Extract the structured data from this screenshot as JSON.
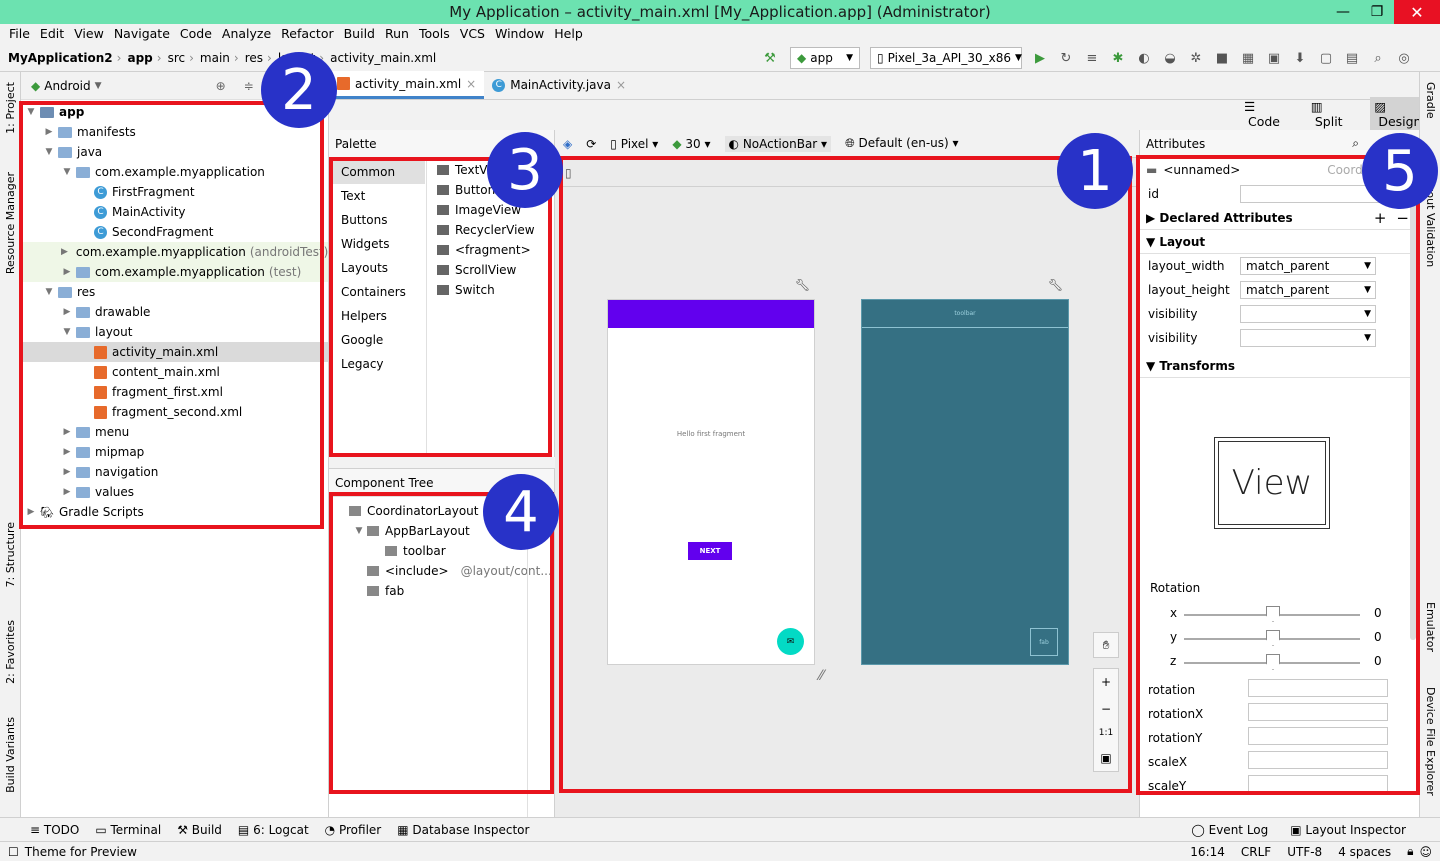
{
  "window": {
    "title": "My Application – activity_main.xml [My_Application.app] (Administrator)",
    "min": "—",
    "restore": "❐",
    "close": "✕"
  },
  "menu": [
    "File",
    "Edit",
    "View",
    "Navigate",
    "Code",
    "Analyze",
    "Refactor",
    "Build",
    "Run",
    "Tools",
    "VCS",
    "Window",
    "Help"
  ],
  "breadcrumbs": [
    "MyApplication2",
    "app",
    "src",
    "main",
    "res",
    "layout",
    "activity_main.xml"
  ],
  "run": {
    "config": "app",
    "device": "Pixel_3a_API_30_x86"
  },
  "left_strip": [
    "1: Project",
    "Resource Manager",
    "7: Structure",
    "2: Favorites",
    "Build Variants"
  ],
  "right_strip": [
    "Gradle",
    "Layout Validation",
    "Emulator",
    "Device File Explorer"
  ],
  "project": {
    "view": "Android",
    "tree": [
      {
        "label": "app",
        "depth": 0,
        "type": "module",
        "arrow": "▼"
      },
      {
        "label": "manifests",
        "depth": 1,
        "type": "folder",
        "arrow": "▶"
      },
      {
        "label": "java",
        "depth": 1,
        "type": "folder",
        "arrow": "▼"
      },
      {
        "label": "com.example.myapplication",
        "depth": 2,
        "type": "folder",
        "arrow": "▼"
      },
      {
        "label": "FirstFragment",
        "depth": 3,
        "type": "class",
        "arrow": ""
      },
      {
        "label": "MainActivity",
        "depth": 3,
        "type": "class",
        "arrow": ""
      },
      {
        "label": "SecondFragment",
        "depth": 3,
        "type": "class",
        "arrow": ""
      },
      {
        "label": "com.example.myapplication",
        "suffix": "(androidTest)",
        "depth": 2,
        "type": "folder",
        "arrow": "▶",
        "test": true
      },
      {
        "label": "com.example.myapplication",
        "suffix": "(test)",
        "depth": 2,
        "type": "folder",
        "arrow": "▶",
        "test": true
      },
      {
        "label": "res",
        "depth": 1,
        "type": "folder",
        "arrow": "▼"
      },
      {
        "label": "drawable",
        "depth": 2,
        "type": "folder",
        "arrow": "▶"
      },
      {
        "label": "layout",
        "depth": 2,
        "type": "folder",
        "arrow": "▼"
      },
      {
        "label": "activity_main.xml",
        "depth": 3,
        "type": "xml",
        "arrow": "",
        "selected": true
      },
      {
        "label": "content_main.xml",
        "depth": 3,
        "type": "xml",
        "arrow": ""
      },
      {
        "label": "fragment_first.xml",
        "depth": 3,
        "type": "xml",
        "arrow": ""
      },
      {
        "label": "fragment_second.xml",
        "depth": 3,
        "type": "xml",
        "arrow": ""
      },
      {
        "label": "menu",
        "depth": 2,
        "type": "folder",
        "arrow": "▶"
      },
      {
        "label": "mipmap",
        "depth": 2,
        "type": "folder",
        "arrow": "▶"
      },
      {
        "label": "navigation",
        "depth": 2,
        "type": "folder",
        "arrow": "▶"
      },
      {
        "label": "values",
        "depth": 2,
        "type": "folder",
        "arrow": "▶"
      },
      {
        "label": "Gradle Scripts",
        "depth": 0,
        "type": "gradle",
        "arrow": "▶"
      }
    ]
  },
  "tabs": [
    {
      "label": "activity_main.xml",
      "active": true
    },
    {
      "label": "MainActivity.java",
      "active": false
    }
  ],
  "view_modes": {
    "code": "Code",
    "split": "Split",
    "design": "Design"
  },
  "palette": {
    "title": "Palette",
    "categories": [
      "Common",
      "Text",
      "Buttons",
      "Widgets",
      "Layouts",
      "Containers",
      "Helpers",
      "Google",
      "Legacy"
    ],
    "items": [
      "TextView",
      "Button",
      "ImageView",
      "RecyclerView",
      "<fragment>",
      "ScrollView",
      "Switch"
    ]
  },
  "design_toolbar": {
    "device": "Pixel",
    "api": "30",
    "theme": "NoActionBar",
    "locale": "Default (en-us)"
  },
  "preview": {
    "text": "Hello first fragment",
    "button": "NEXT",
    "blueprint_toolbar": "toolbar",
    "blueprint_fab": "fab"
  },
  "zoom": {
    "one_to_one": "1:1"
  },
  "component_tree": {
    "title": "Component Tree",
    "nodes": [
      {
        "label": "CoordinatorLayout",
        "depth": 0,
        "arrow": ""
      },
      {
        "label": "AppBarLayout",
        "depth": 1,
        "arrow": "▼"
      },
      {
        "label": "toolbar",
        "depth": 2,
        "arrow": ""
      },
      {
        "label": "<include>",
        "suffix": "@layout/cont...",
        "depth": 1,
        "arrow": ""
      },
      {
        "label": "fab",
        "depth": 1,
        "arrow": ""
      }
    ]
  },
  "attributes": {
    "title": "Attributes",
    "component": "<unnamed>",
    "component_type": "Coordina",
    "id_label": "id",
    "declared": "Declared Attributes",
    "layout": "Layout",
    "layout_rows": [
      {
        "label": "layout_width",
        "value": "match_parent"
      },
      {
        "label": "layout_height",
        "value": "match_parent"
      },
      {
        "label": "visibility",
        "value": ""
      },
      {
        "label": "visibility",
        "value": ""
      }
    ],
    "transforms": "Transforms",
    "view_label": "View",
    "rotation": "Rotation",
    "axes": [
      {
        "label": "x",
        "value": "0"
      },
      {
        "label": "y",
        "value": "0"
      },
      {
        "label": "z",
        "value": "0"
      }
    ],
    "fields": [
      "rotation",
      "rotationX",
      "rotationY",
      "scaleX",
      "scaleY"
    ]
  },
  "bottom_tools": [
    "TODO",
    "Terminal",
    "Build",
    "6: Logcat",
    "Profiler",
    "Database Inspector"
  ],
  "bottom_right": [
    "Event Log",
    "Layout Inspector"
  ],
  "status": {
    "message": "Theme for Preview",
    "position": "16:14",
    "line_sep": "CRLF",
    "encoding": "UTF-8",
    "indent": "4 spaces"
  },
  "callouts": [
    "1",
    "2",
    "3",
    "4",
    "5"
  ],
  "colors": {
    "titlebar": "#6ce2b0",
    "appbar": "#6200ee",
    "fab": "#03dac5",
    "blueprint": "#357083",
    "callout": "#2832c8",
    "highlight": "#e8141d"
  }
}
